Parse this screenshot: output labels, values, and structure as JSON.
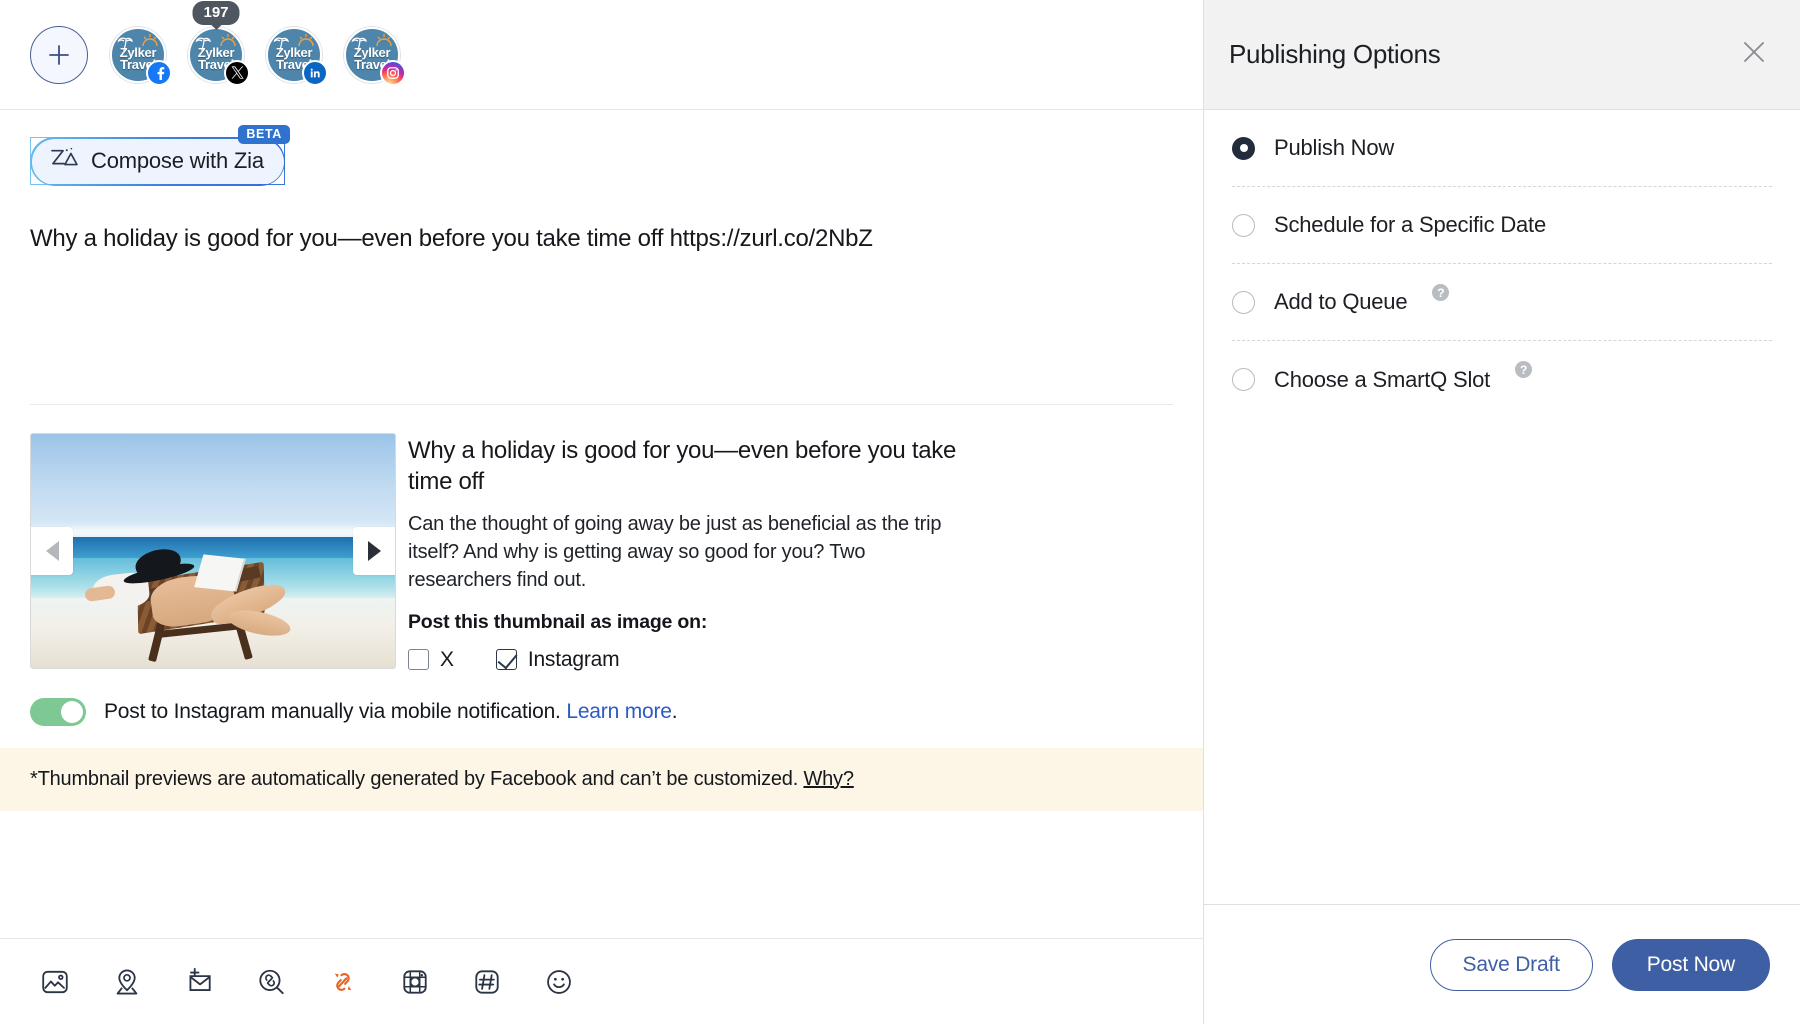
{
  "accounts_bar": {
    "add_account_icon": "plus-icon",
    "accounts": [
      {
        "name": "Zylker Travel",
        "network": "facebook",
        "badge": null
      },
      {
        "name": "Zylker Travel",
        "network": "x",
        "badge": "197"
      },
      {
        "name": "Zylker Travel",
        "network": "linkedin",
        "badge": null
      },
      {
        "name": "Zylker Travel",
        "network": "instagram",
        "badge": null
      }
    ]
  },
  "composer": {
    "zia_button_label": "Compose with Zia",
    "zia_badge": "BETA",
    "zia_icon": "zia-icon",
    "post_text": "Why a holiday is good for you—even before you take time off https://zurl.co/2NbZ",
    "link_preview": {
      "title": "Why a holiday is good for you—even before you take time off",
      "description": "Can the thought of going away be just as beneficial as the trip itself? And why is getting away so good for you? Two researchers find out.",
      "prev_arrow": "chevron-left-icon",
      "next_arrow": "chevron-right-icon",
      "thumbnail_alt": "Person relaxing on a beach lounge chair reading a newspaper"
    },
    "thumbnail_as_image": {
      "label": "Post this thumbnail as image on:",
      "options": [
        {
          "label": "X",
          "checked": false
        },
        {
          "label": "Instagram",
          "checked": true
        }
      ]
    },
    "instagram_toggle": {
      "enabled": true,
      "text": "Post to Instagram manually via mobile notification.",
      "link_text": "Learn more",
      "trailing": "."
    },
    "warning_banner": {
      "text": "*Thumbnail previews are automatically generated by Facebook and can’t be customized.",
      "link_text": "Why?"
    },
    "toolbar_icons": [
      {
        "name": "image-icon",
        "active": false
      },
      {
        "name": "location-pin-icon",
        "active": false
      },
      {
        "name": "add-to-draft-icon",
        "active": false
      },
      {
        "name": "link-preview-icon",
        "active": false
      },
      {
        "name": "shorten-link-icon",
        "active": true
      },
      {
        "name": "sticker-icon",
        "active": false
      },
      {
        "name": "hashtag-icon",
        "active": false
      },
      {
        "name": "emoji-icon",
        "active": false
      }
    ]
  },
  "panel": {
    "title": "Publishing Options",
    "close_icon": "close-icon",
    "options": [
      {
        "label": "Publish Now",
        "selected": true,
        "help": false
      },
      {
        "label": "Schedule for a Specific Date",
        "selected": false,
        "help": false
      },
      {
        "label": "Add to Queue",
        "selected": false,
        "help": true
      },
      {
        "label": "Choose a SmartQ Slot",
        "selected": false,
        "help": true
      }
    ],
    "help_glyph": "?",
    "footer": {
      "save_draft_label": "Save Draft",
      "post_now_label": "Post Now"
    }
  },
  "colors": {
    "primary_blue": "#3f5fa5",
    "accent_orange": "#e8631f",
    "toggle_green": "#7ec894",
    "warning_bg": "#fdf5e6",
    "panel_header_bg": "#f2f2f2",
    "link_blue": "#2c5bc4"
  }
}
